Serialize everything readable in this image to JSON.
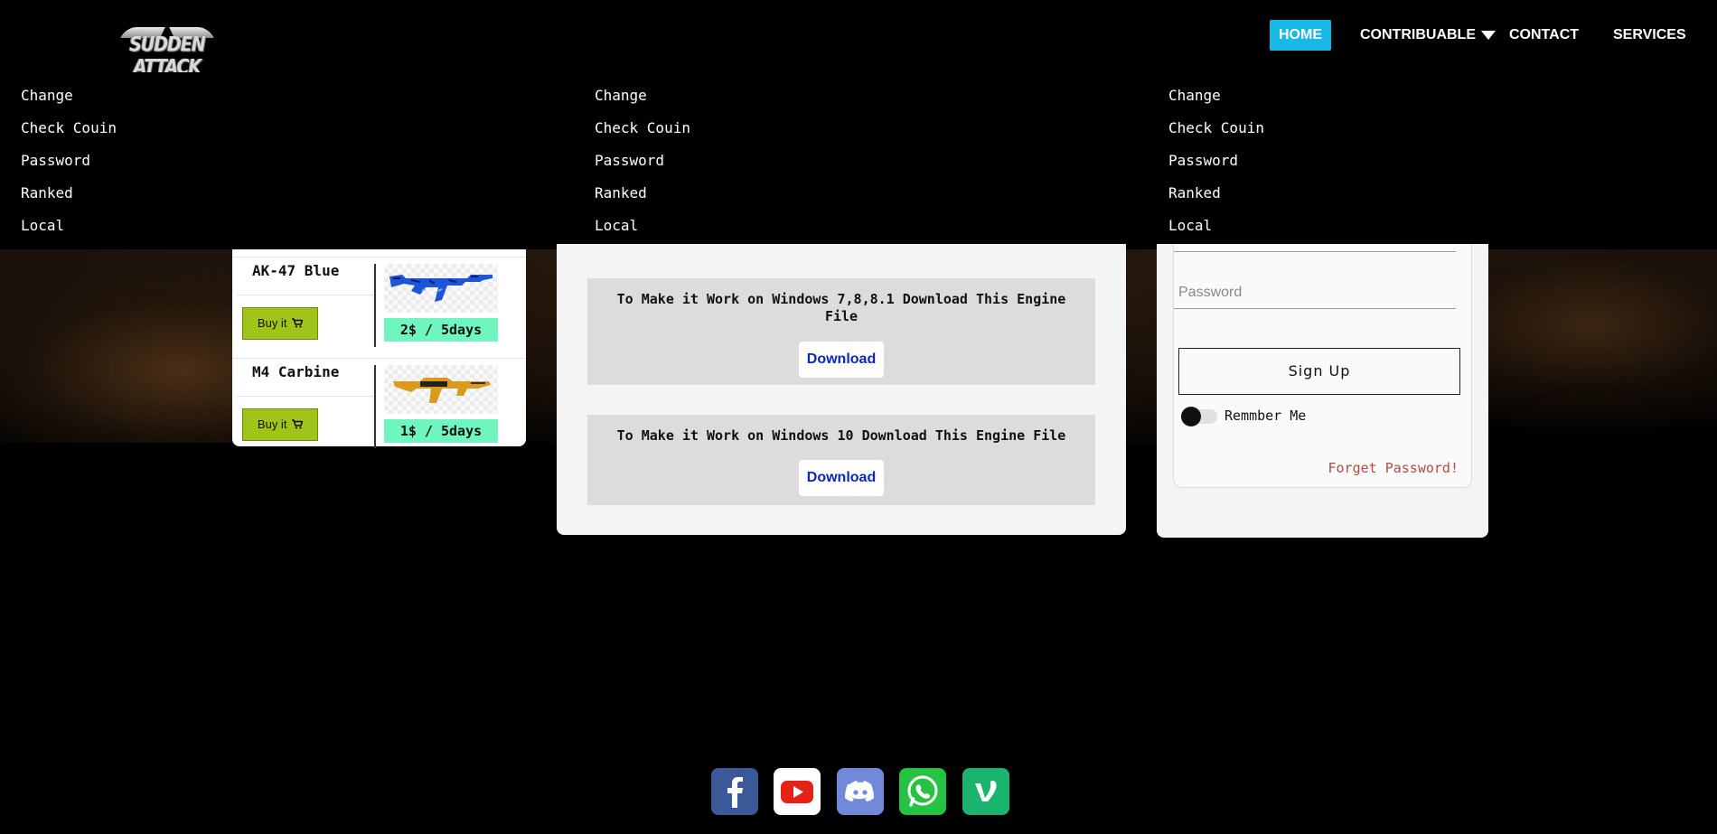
{
  "brand": {
    "logo_text": "SUDDEN ATTACK"
  },
  "nav": {
    "home": "HOME",
    "contribuable": "CONTRIBUABLE",
    "contact": "CONTACT",
    "services": "SERVICES"
  },
  "dropdown": {
    "columns": [
      [
        "Change",
        "Check Couin",
        "Password",
        "Ranked",
        "Local"
      ],
      [
        "Change",
        "Check Couin",
        "Password",
        "Ranked",
        "Local"
      ],
      [
        "Change",
        "Check Couin",
        "Password",
        "Ranked",
        "Local"
      ]
    ]
  },
  "shop": {
    "items": [
      {
        "name": "AK-47 Blue",
        "buy_label": "Buy it",
        "price": "2$ / 5days"
      },
      {
        "name": "M4 Carbine",
        "buy_label": "Buy it",
        "price": "1$ / 5days"
      }
    ]
  },
  "downloads": [
    {
      "text": "To Make it Work on Windows 7,8,8.1 Download This Engine File",
      "button": "Download"
    },
    {
      "text": "To Make it Work on Windows 10 Download This Engine File",
      "button": "Download"
    }
  ],
  "login": {
    "password_placeholder": "Password",
    "signup": "Sign Up",
    "remember": "Remmber Me",
    "forget": "Forget Password!"
  },
  "colors": {
    "nav_active": "#1ab8e6",
    "buy_button": "#a1c41a",
    "price_tag": "#6ff5c0",
    "download_link": "#0b26c4",
    "forget_link": "#b04a42"
  },
  "social": [
    "facebook-icon",
    "youtube-icon",
    "discord-icon",
    "whatsapp-icon",
    "vine-icon"
  ]
}
